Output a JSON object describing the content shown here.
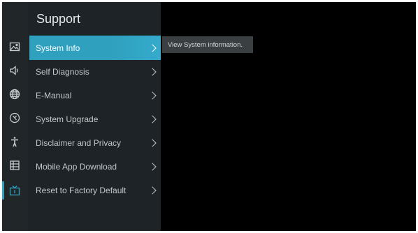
{
  "panel": {
    "title": "Support",
    "items": [
      {
        "label": "System Info"
      },
      {
        "label": "Self Diagnosis"
      },
      {
        "label": "E-Manual"
      },
      {
        "label": "System Upgrade"
      },
      {
        "label": "Disclaimer and Privacy"
      },
      {
        "label": "Mobile App Download"
      },
      {
        "label": "Reset to Factory Default"
      }
    ],
    "selected_index": 0
  },
  "tooltip": {
    "text": "View System information."
  },
  "sidebar_icons": [
    "picture-icon",
    "sound-icon",
    "network-globe-icon",
    "general-settings-icon",
    "accessibility-icon",
    "system-grid-icon",
    "support-tv-icon"
  ],
  "colors": {
    "accent": "#2fa0bd",
    "panel_bg": "#1d2326",
    "iconbar_bg": "#212729",
    "screen_bg": "#000000"
  }
}
